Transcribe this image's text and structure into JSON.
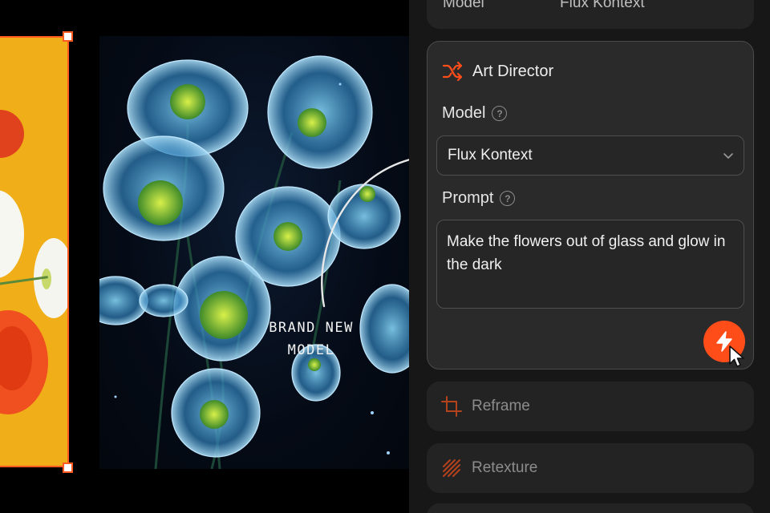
{
  "canvas": {
    "label": "BRAND NEW\nMODEL"
  },
  "panel": {
    "top_card": {
      "key": "Model",
      "value": "Flux Kontext"
    },
    "art_director": {
      "title": "Art Director",
      "model_label": "Model",
      "model_value": "Flux Kontext",
      "prompt_label": "Prompt",
      "prompt_value": "Make the flowers out of glass and glow in the dark",
      "help_glyph": "?"
    },
    "tools": [
      {
        "label": "Reframe",
        "icon": "crop-icon"
      },
      {
        "label": "Retexture",
        "icon": "texture-icon"
      }
    ]
  },
  "colors": {
    "accent": "#ff4d1a",
    "panel_bg": "#171717",
    "card_bg": "#232323",
    "source_bg": "#f0ae19"
  }
}
